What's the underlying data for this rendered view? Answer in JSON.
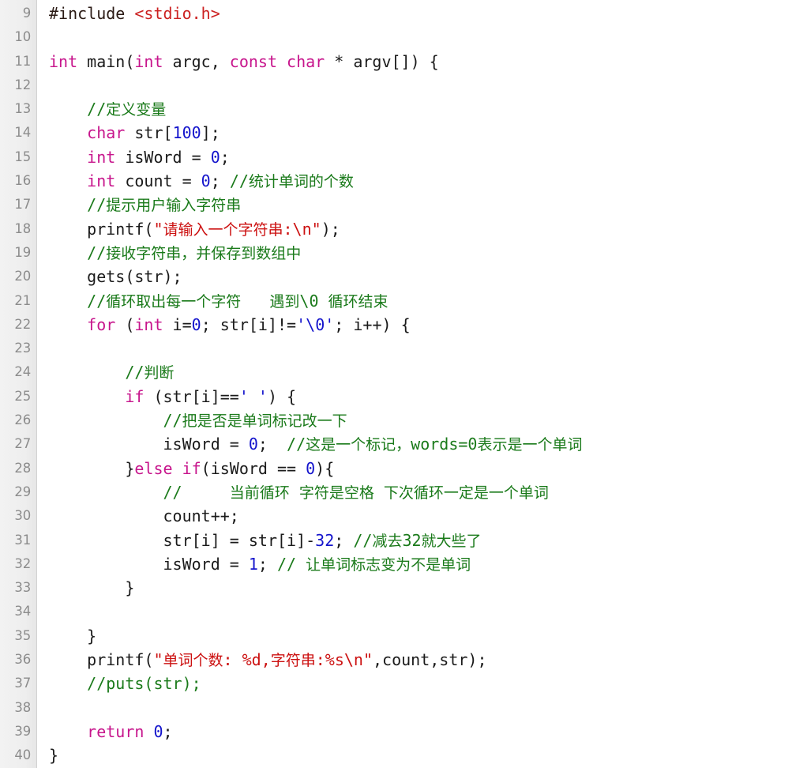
{
  "editor": {
    "language": "c",
    "first_line_number": 9,
    "last_line_number": 40,
    "gutter_color": "#eeeeee",
    "background_color": "#ffffff",
    "colors": {
      "keyword": "#c7158c",
      "number": "#1414cc",
      "string": "#cc1111",
      "comment": "#1a7a1a",
      "preprocessor": "#2a1a14",
      "include_path": "#cc2222",
      "char_literal": "#1414cc",
      "plain_text": "#1a1a1a",
      "line_number": "#8c8c8c"
    }
  },
  "lines": [
    {
      "n": "9",
      "tokens": [
        {
          "t": "#include ",
          "c": "pre"
        },
        {
          "t": "<stdio.h>",
          "c": "inc"
        }
      ]
    },
    {
      "n": "10",
      "tokens": []
    },
    {
      "n": "11",
      "tokens": [
        {
          "t": "int",
          "c": "kw"
        },
        {
          "t": " main(",
          "c": "pln"
        },
        {
          "t": "int",
          "c": "kw"
        },
        {
          "t": " argc, ",
          "c": "pln"
        },
        {
          "t": "const char",
          "c": "kw"
        },
        {
          "t": " * argv[]) {",
          "c": "pln"
        }
      ]
    },
    {
      "n": "12",
      "tokens": []
    },
    {
      "n": "13",
      "tokens": [
        {
          "t": "    ",
          "c": "pln"
        },
        {
          "t": "//定义变量",
          "c": "cmt"
        }
      ]
    },
    {
      "n": "14",
      "tokens": [
        {
          "t": "    ",
          "c": "pln"
        },
        {
          "t": "char",
          "c": "kw"
        },
        {
          "t": " str[",
          "c": "pln"
        },
        {
          "t": "100",
          "c": "num"
        },
        {
          "t": "];",
          "c": "pln"
        }
      ]
    },
    {
      "n": "15",
      "tokens": [
        {
          "t": "    ",
          "c": "pln"
        },
        {
          "t": "int",
          "c": "kw"
        },
        {
          "t": " isWord = ",
          "c": "pln"
        },
        {
          "t": "0",
          "c": "num"
        },
        {
          "t": ";",
          "c": "pln"
        }
      ]
    },
    {
      "n": "16",
      "tokens": [
        {
          "t": "    ",
          "c": "pln"
        },
        {
          "t": "int",
          "c": "kw"
        },
        {
          "t": " count = ",
          "c": "pln"
        },
        {
          "t": "0",
          "c": "num"
        },
        {
          "t": "; ",
          "c": "pln"
        },
        {
          "t": "//统计单词的个数",
          "c": "cmt"
        }
      ]
    },
    {
      "n": "17",
      "tokens": [
        {
          "t": "    ",
          "c": "pln"
        },
        {
          "t": "//提示用户输入字符串",
          "c": "cmt"
        }
      ]
    },
    {
      "n": "18",
      "tokens": [
        {
          "t": "    printf(",
          "c": "pln"
        },
        {
          "t": "\"请输入一个字符串:\\n\"",
          "c": "str"
        },
        {
          "t": ");",
          "c": "pln"
        }
      ]
    },
    {
      "n": "19",
      "tokens": [
        {
          "t": "    ",
          "c": "pln"
        },
        {
          "t": "//接收字符串，并保存到数组中",
          "c": "cmt"
        }
      ]
    },
    {
      "n": "20",
      "tokens": [
        {
          "t": "    gets(str);",
          "c": "pln"
        }
      ]
    },
    {
      "n": "21",
      "tokens": [
        {
          "t": "    ",
          "c": "pln"
        },
        {
          "t": "//循环取出每一个字符   遇到\\0 循环结束",
          "c": "cmt"
        }
      ]
    },
    {
      "n": "22",
      "tokens": [
        {
          "t": "    ",
          "c": "pln"
        },
        {
          "t": "for",
          "c": "kw"
        },
        {
          "t": " (",
          "c": "pln"
        },
        {
          "t": "int",
          "c": "kw"
        },
        {
          "t": " i=",
          "c": "pln"
        },
        {
          "t": "0",
          "c": "num"
        },
        {
          "t": "; str[i]!=",
          "c": "pln"
        },
        {
          "t": "'\\0'",
          "c": "chr"
        },
        {
          "t": "; i++) {",
          "c": "pln"
        }
      ]
    },
    {
      "n": "23",
      "tokens": []
    },
    {
      "n": "24",
      "tokens": [
        {
          "t": "        ",
          "c": "pln"
        },
        {
          "t": "//判断",
          "c": "cmt"
        }
      ]
    },
    {
      "n": "25",
      "tokens": [
        {
          "t": "        ",
          "c": "pln"
        },
        {
          "t": "if",
          "c": "kw"
        },
        {
          "t": " (str[i]==",
          "c": "pln"
        },
        {
          "t": "' '",
          "c": "chr"
        },
        {
          "t": ") {",
          "c": "pln"
        }
      ]
    },
    {
      "n": "26",
      "tokens": [
        {
          "t": "            ",
          "c": "pln"
        },
        {
          "t": "//把是否是单词标记改一下",
          "c": "cmt"
        }
      ]
    },
    {
      "n": "27",
      "tokens": [
        {
          "t": "            isWord = ",
          "c": "pln"
        },
        {
          "t": "0",
          "c": "num"
        },
        {
          "t": ";  ",
          "c": "pln"
        },
        {
          "t": "//这是一个标记，words=0表示是一个单词",
          "c": "cmt"
        }
      ]
    },
    {
      "n": "28",
      "tokens": [
        {
          "t": "        }",
          "c": "pln"
        },
        {
          "t": "else if",
          "c": "kw"
        },
        {
          "t": "(isWord == ",
          "c": "pln"
        },
        {
          "t": "0",
          "c": "num"
        },
        {
          "t": "){",
          "c": "pln"
        }
      ]
    },
    {
      "n": "29",
      "tokens": [
        {
          "t": "            ",
          "c": "pln"
        },
        {
          "t": "//     当前循环 字符是空格 下次循环一定是一个单词",
          "c": "cmt"
        }
      ]
    },
    {
      "n": "30",
      "tokens": [
        {
          "t": "            count++;",
          "c": "pln"
        }
      ]
    },
    {
      "n": "31",
      "tokens": [
        {
          "t": "            str[i] = str[i]-",
          "c": "pln"
        },
        {
          "t": "32",
          "c": "num"
        },
        {
          "t": "; ",
          "c": "pln"
        },
        {
          "t": "//减去32就大些了",
          "c": "cmt"
        }
      ]
    },
    {
      "n": "32",
      "tokens": [
        {
          "t": "            isWord = ",
          "c": "pln"
        },
        {
          "t": "1",
          "c": "num"
        },
        {
          "t": "; ",
          "c": "pln"
        },
        {
          "t": "// 让单词标志变为不是单词",
          "c": "cmt"
        }
      ]
    },
    {
      "n": "33",
      "tokens": [
        {
          "t": "        }",
          "c": "pln"
        }
      ]
    },
    {
      "n": "34",
      "tokens": []
    },
    {
      "n": "35",
      "tokens": [
        {
          "t": "    }",
          "c": "pln"
        }
      ]
    },
    {
      "n": "36",
      "tokens": [
        {
          "t": "    printf(",
          "c": "pln"
        },
        {
          "t": "\"单词个数: %d,字符串:%s\\n\"",
          "c": "str"
        },
        {
          "t": ",count,str);",
          "c": "pln"
        }
      ]
    },
    {
      "n": "37",
      "tokens": [
        {
          "t": "    ",
          "c": "pln"
        },
        {
          "t": "//puts(str);",
          "c": "cmt"
        }
      ]
    },
    {
      "n": "38",
      "tokens": []
    },
    {
      "n": "39",
      "tokens": [
        {
          "t": "    ",
          "c": "pln"
        },
        {
          "t": "return",
          "c": "kw"
        },
        {
          "t": " ",
          "c": "pln"
        },
        {
          "t": "0",
          "c": "num"
        },
        {
          "t": ";",
          "c": "pln"
        }
      ]
    },
    {
      "n": "40",
      "tokens": [
        {
          "t": "}",
          "c": "pln"
        }
      ]
    }
  ]
}
